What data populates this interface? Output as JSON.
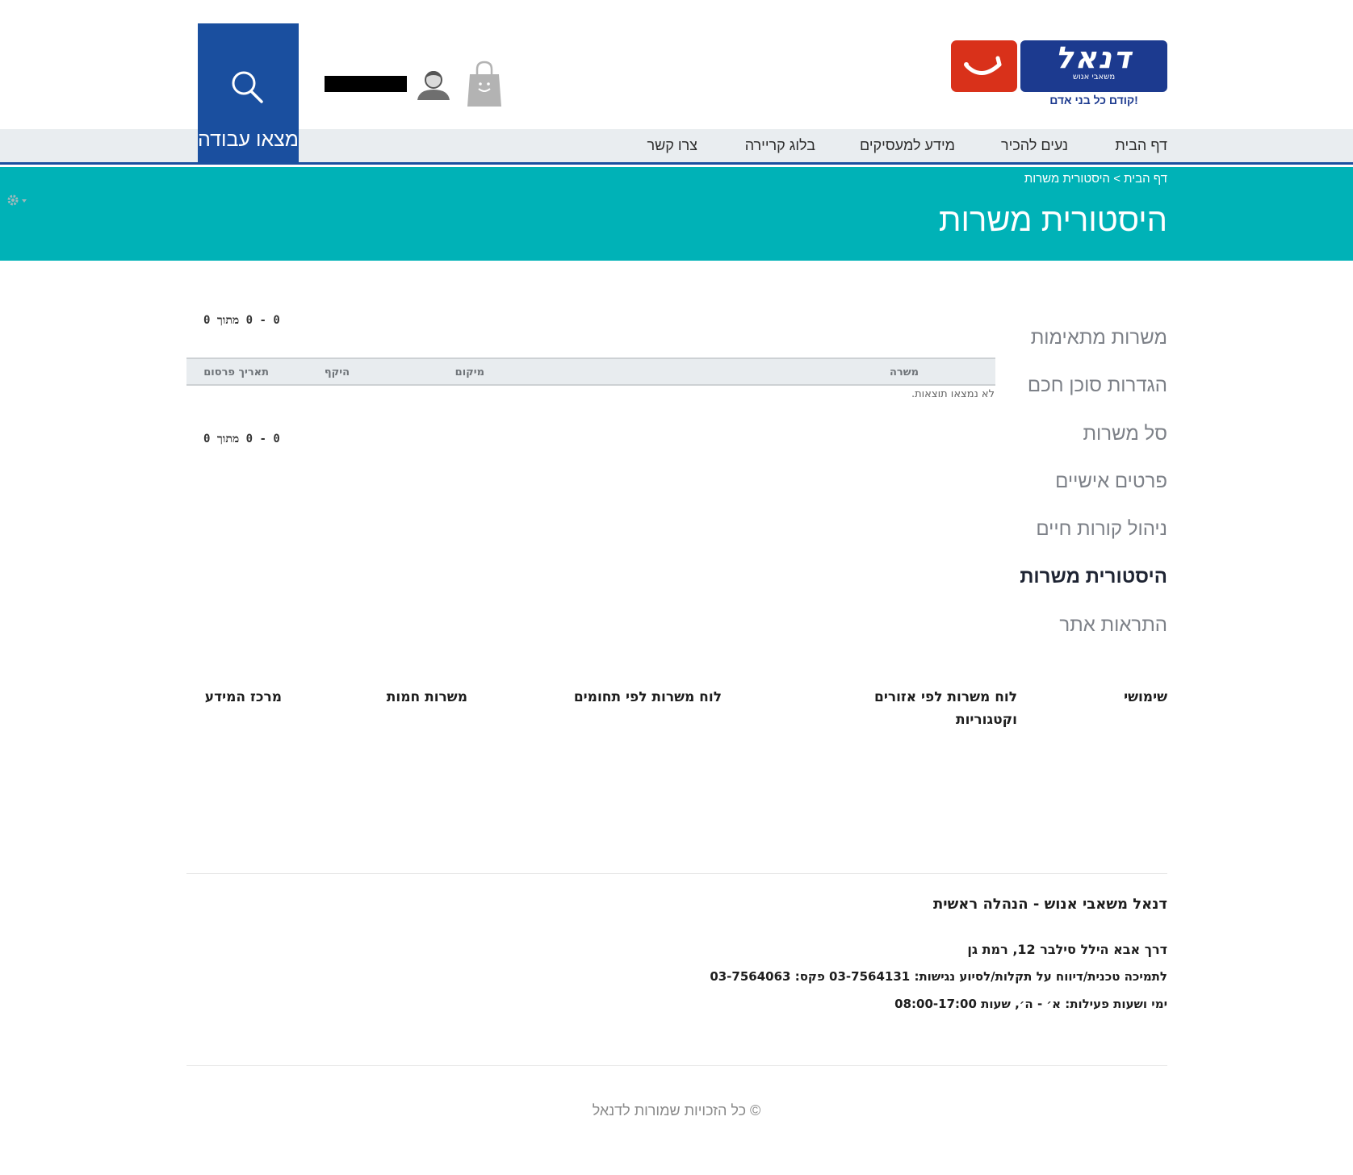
{
  "header": {
    "find_job_label": "מצאו עבודה",
    "logo": {
      "brand": "דנאל",
      "subtitle": "משאבי אנוש",
      "tagline": "קודם כל בני אדם!"
    }
  },
  "nav": {
    "items": [
      "דף הבית",
      "נעים להכיר",
      "מידע למעסיקים",
      "בלוג קריירה",
      "צרו קשר"
    ]
  },
  "banner": {
    "breadcrumb_home": "דף הבית",
    "breadcrumb_sep": ">",
    "breadcrumb_current": "היסטורית משרות",
    "title": "היסטורית משרות"
  },
  "sidebar": {
    "items": [
      "משרות מתאימות",
      "הגדרות סוכן חכם",
      "סל משרות",
      "פרטים אישיים",
      "ניהול קורות חיים",
      "היסטורית משרות",
      "התראות אתר"
    ],
    "active_index": 5
  },
  "results": {
    "pager_top": "0 - 0 מתוך 0",
    "pager_bottom": "0 - 0 מתוך 0",
    "columns": {
      "job": "משרה",
      "location": "מיקום",
      "scope": "היקף",
      "date": "תאריך פרסום"
    },
    "empty_message": "לא נמצאו תוצאות."
  },
  "footer_links": {
    "useful": "שימושי",
    "by_region_line1": "לוח משרות לפי אזורים",
    "by_region_line2": "וקטגוריות",
    "by_field": "לוח משרות לפי תחומים",
    "hot_jobs": "משרות חמות",
    "info_center": "מרכז המידע"
  },
  "company": {
    "name": "דנאל משאבי אנוש - הנהלה ראשית",
    "address": "דרך אבא הילל סילבר 12, רמת גן",
    "support": "לתמיכה טכנית/דיווח על תקלות/לסיוע נגישות: 03-7564131 פקס: 03-7564063",
    "hours": "ימי ושעות פעילות: א׳ - ה׳, שעות 08:00-17:00"
  },
  "copyright": "© כל הזכויות שמורות לדנאל",
  "icons": {
    "search": "search-icon",
    "user": "user-icon",
    "bag": "shopping-bag-icon",
    "gear": "gear-icon",
    "logo_smile": "smile-icon"
  },
  "colors": {
    "brand_blue": "#1a4f9f",
    "teal": "#00b2b7",
    "logo_red": "#d9311a",
    "nav_bg": "#e9edf0"
  }
}
